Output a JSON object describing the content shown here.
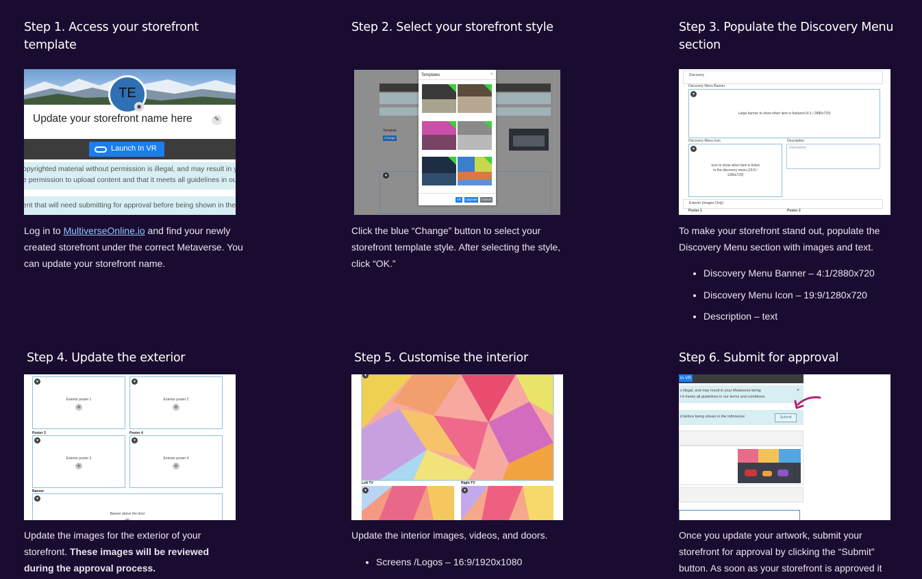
{
  "steps": [
    {
      "title": "Step 1.  Access your storefront template",
      "desc_prefix": "Log in to ",
      "desc_link": "MultiverseOnline.io",
      "desc_suffix": " and find your newly created storefront under the correct Metaverse. You can update your storefront name.",
      "shot": {
        "avatar": "TE",
        "name_placeholder": "Update your storefront name here",
        "launch_label": "Launch In VR",
        "notice1_line1": "opyrighted material without permission is illegal, and may result in your M",
        "notice1_line2": "e permission to upload content and that it meets all guidelines in our te",
        "notice2": "ent that will need submitting for approval before being shown in the Infi"
      }
    },
    {
      "title": "Step 2. Select your storefront style",
      "desc": "Click the blue “Change” button to select your storefront template style. After selecting the style, click “OK.”",
      "shot": {
        "modal_title": "Templates",
        "ok_label": "Ok",
        "upgrade_label": "Upgrade",
        "cancel_label": "Cancel",
        "template_label": "Template",
        "change_label": "Change"
      }
    },
    {
      "title": "Step 3. Populate the Discovery Menu section",
      "desc": "To make your storefront stand out, populate the Discovery Menu section with images and text.",
      "bullets": [
        "Discovery Menu Banner – 4:1/2880x720",
        "Discovery Menu Icon – 19:9/1280x720",
        "Description – text"
      ],
      "shot": {
        "section": "Discovery",
        "banner_label": "Discovery Menu Banner",
        "banner_text": "Large banner to show when item is featured (4:1 / 2880x720)",
        "icon_label": "Discovery Menu Icon",
        "icon_text": "Icon to show when item is listed in the discovery menu (16:9 / 1280x720)",
        "description_label": "Description",
        "description_placeholder": "Description",
        "exterior_label": "Exterior (Images Only)",
        "poster1": "Poster 1",
        "poster2": "Poster 2"
      }
    },
    {
      "title": "Step 4. Update the exterior",
      "desc_plain": "Update the images for the exterior of your storefront. ",
      "desc_bold": "These images will be reviewed during the approval process.",
      "shot": {
        "poster1": "Exterior poster 1",
        "poster2": "Exterior poster 2",
        "poster3_label": "Poster 3",
        "poster4_label": "Poster 4",
        "poster3": "Exterior poster 3",
        "poster4": "Exterior poster 4",
        "banner_label": "Banner",
        "banner_text": "Banner above the door"
      }
    },
    {
      "title": "Step 5. Customise the interior",
      "desc": "Update the interior images, videos, and doors.",
      "bullets": [
        "Screens /Logos – 16:9/1920x1080"
      ],
      "shot": {
        "left_tv": "Left TV",
        "right_tv": "Right TV"
      }
    },
    {
      "title": "Step 6. Submit for approval",
      "desc": "Once you update your artwork, submit your storefront for approval by clicking the “Submit” button. As soon as your storefront is approved it",
      "shot": {
        "launch_partial": "In VR",
        "notice_line1": "s illegal, and may result in your Metaverse being",
        "notice_line2": "t it meets all guidelines in our terms and conditions.",
        "notice_line3": "d before being shown in the Infiniverse",
        "submit_label": "Submit"
      }
    }
  ],
  "colors": {
    "background": "#1a0c30",
    "accent_blue": "#1a7ef0",
    "arrow": "#b0236e"
  }
}
